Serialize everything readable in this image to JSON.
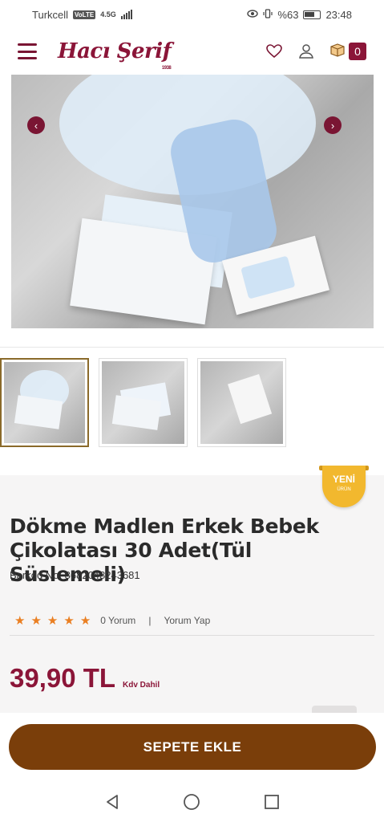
{
  "status_bar": {
    "carrier": "Turkcell",
    "volte": "VoLTE",
    "network": "4.5G",
    "battery_text": "%63",
    "time": "23:48"
  },
  "header": {
    "logo_text": "Hacı Şerif",
    "logo_year": "1938",
    "cart_count": "0",
    "icons": [
      "menu-icon",
      "heart-icon",
      "user-icon",
      "cart-icon"
    ]
  },
  "gallery": {
    "thumbnail_count": 3,
    "active_thumbnail": 1
  },
  "product": {
    "badge_line1": "YENİ",
    "badge_line2": "ÜRÜN",
    "title": "Dökme Madlen Erkek Bebek Çikolatası 30 Adet(Tül Süslemeli)",
    "barcode": "Barkod No: 8682048243681",
    "rating_stars": 5,
    "review_count": "0 Yorum",
    "separator": "|",
    "write_review": "Yorum Yap",
    "price": "39,90 TL",
    "tax_note": "Kdv Dahil"
  },
  "actions": {
    "add_to_cart": "SEPETE EKLE"
  },
  "colors": {
    "brand": "#8b1538",
    "button": "#7a3e0a",
    "star": "#ea7f22",
    "badge": "#f2b82e"
  }
}
